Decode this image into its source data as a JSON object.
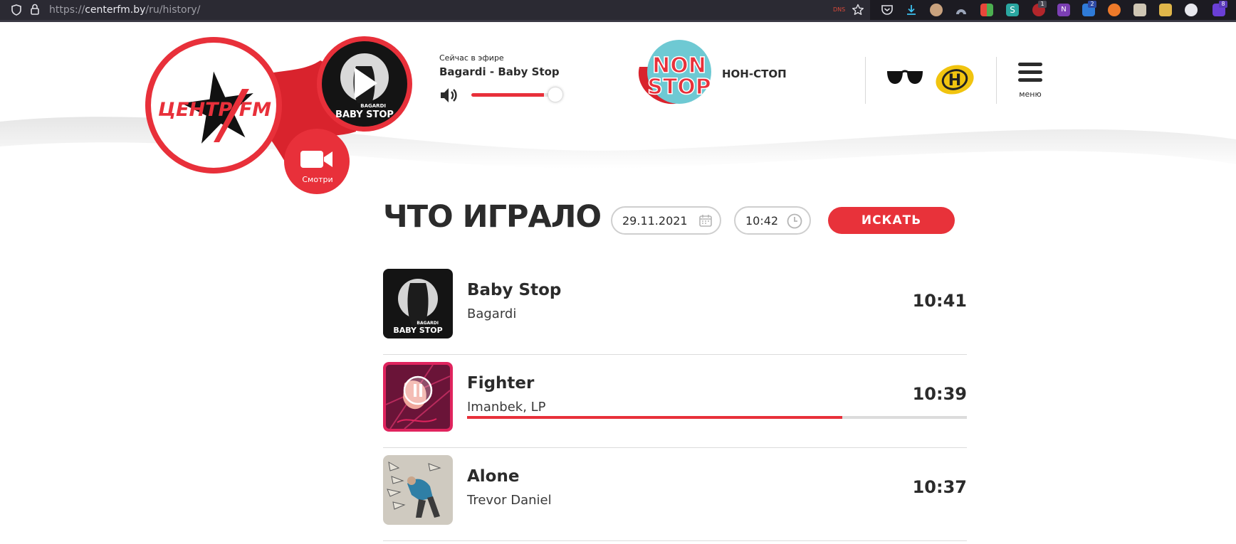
{
  "browser": {
    "url_prefix": "https://",
    "url_host": "centerfm.by",
    "url_path": "/ru/history/",
    "dns_label": "DNS",
    "badges": [
      "1",
      "2",
      "8"
    ]
  },
  "header": {
    "logo_text": "ЦЕНТР FM",
    "cover_text_artist": "BAGARDI",
    "cover_text_title": "BABY STOP",
    "watch_label": "Смотри",
    "now_playing_label": "Сейчас в эфире",
    "now_playing_title": "Bagardi - Baby Stop",
    "volume_level": 0.85,
    "nonstop_logo_line1": "NON",
    "nonstop_logo_line2": "STOP",
    "nonstop_label": "НОН-СТОП",
    "ont_logo_letter": "Н",
    "menu_label": "меню"
  },
  "history": {
    "title": "ЧТО ИГРАЛО",
    "date_value": "29.11.2021",
    "time_value": "10:42",
    "search_label": "ИСКАТЬ",
    "tracks": [
      {
        "title": "Baby Stop",
        "artist": "Bagardi",
        "time": "10:41",
        "cover_text_artist": "BAGARDI",
        "cover_text_title": "BABY STOP"
      },
      {
        "title": "Fighter",
        "artist": "Imanbek, LP",
        "time": "10:39",
        "progress": 0.75
      },
      {
        "title": "Alone",
        "artist": "Trevor Daniel",
        "time": "10:37"
      }
    ]
  },
  "colors": {
    "brand_red": "#e8303a",
    "text_dark": "#2b2b2b",
    "browser_bg": "#1c1b22"
  }
}
